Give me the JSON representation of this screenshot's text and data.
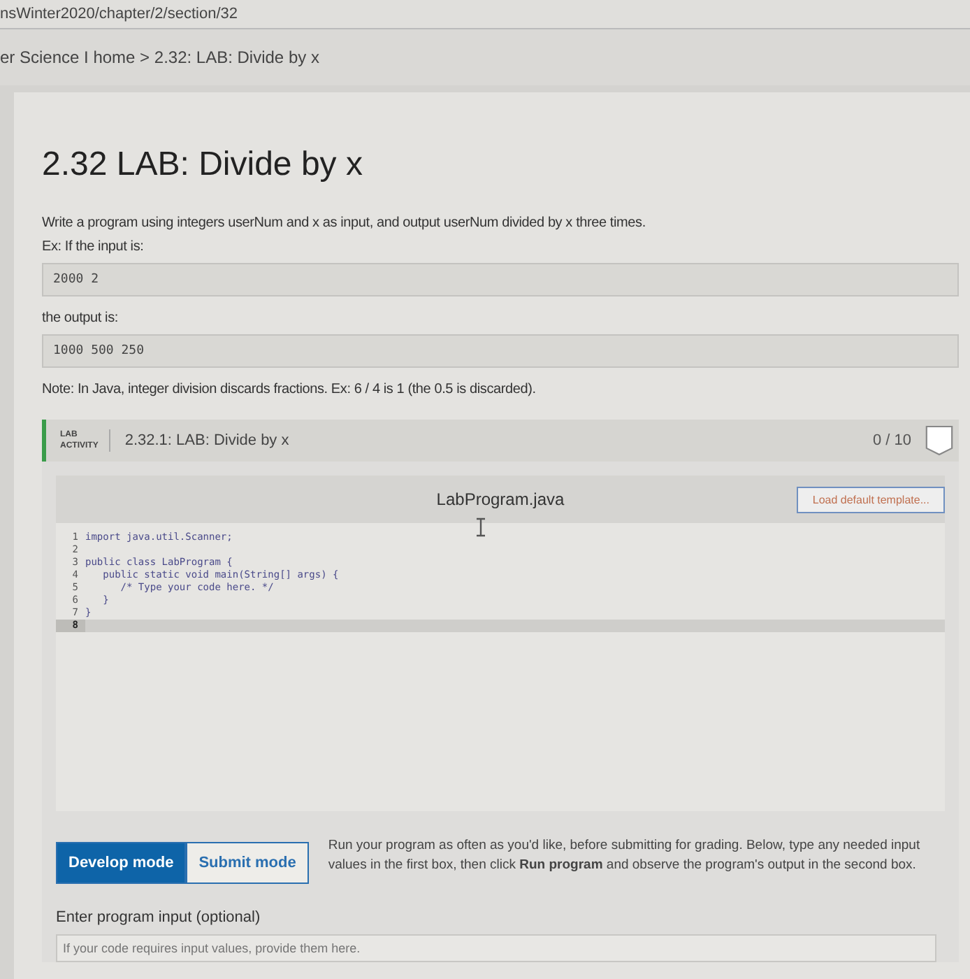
{
  "address_bar": {
    "url": "nsWinter2020/chapter/2/section/32"
  },
  "breadcrumb": {
    "text": "er Science I home > 2.32: LAB: Divide by x"
  },
  "section": {
    "title": "2.32 LAB: Divide by x",
    "paragraphs": [
      {
        "kind": "text",
        "text": "Write a program using integers userNum and x as input, and output userNum divided by x three times."
      },
      {
        "kind": "text",
        "text": "Ex: If the input is:"
      },
      {
        "kind": "sample",
        "text": "2000 2"
      },
      {
        "kind": "text",
        "text": "the output is:"
      },
      {
        "kind": "sample",
        "text": "1000 500 250"
      },
      {
        "kind": "text",
        "text": "Note: In Java, integer division discards fractions. Ex: 6 / 4 is 1 (the 0.5 is discarded)."
      }
    ]
  },
  "lab_activity": {
    "badge_line_1": "LAB",
    "badge_line_2": "ACTIVITY",
    "title": "2.32.1: LAB: Divide by x",
    "score": "0 / 10",
    "editor": {
      "filename": "LabProgram.java",
      "template_button": "Load default template...",
      "lines": [
        {
          "number": "1",
          "code": "import java.util.Scanner;",
          "current": false
        },
        {
          "number": "2",
          "current": false
        },
        {
          "number": "3",
          "code": "public class LabProgram {",
          "current": false
        },
        {
          "number": "4",
          "code": "   public static void main(String[] args) {",
          "current": false
        },
        {
          "number": "5",
          "code": "      /* Type your code here. */",
          "current": false
        },
        {
          "number": "6",
          "code": "   }",
          "current": false
        },
        {
          "number": "7",
          "code": "}",
          "current": false
        },
        {
          "number": "8",
          "current": true
        }
      ]
    },
    "modes": [
      {
        "label": "Develop mode",
        "selected": true
      },
      {
        "label": "Submit mode",
        "selected": false
      }
    ],
    "mode_help": "Run your program as often as you'd like, before submitting for grading. Below, type any needed input values in the first box, then click **Run program** and observe the program's output in the second box.",
    "input_label": "Enter program input (optional)",
    "input_placeholder": "If your code requires input values, provide them here."
  }
}
